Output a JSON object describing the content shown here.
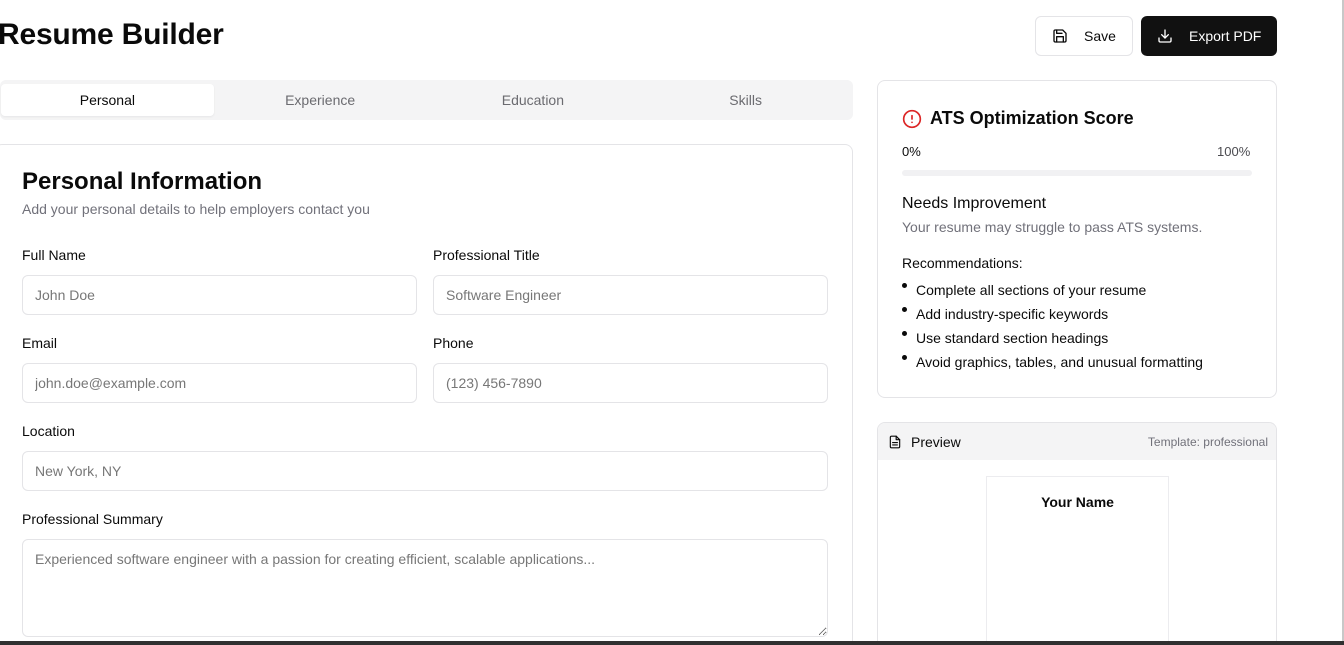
{
  "header": {
    "title": "Resume Builder",
    "save_label": "Save",
    "export_label": "Export PDF"
  },
  "tabs": [
    {
      "label": "Personal",
      "active": true
    },
    {
      "label": "Experience",
      "active": false
    },
    {
      "label": "Education",
      "active": false
    },
    {
      "label": "Skills",
      "active": false
    }
  ],
  "personal": {
    "title": "Personal Information",
    "subtitle": "Add your personal details to help employers contact you",
    "fields": {
      "full_name": {
        "label": "Full Name",
        "placeholder": "John Doe",
        "value": ""
      },
      "professional_title": {
        "label": "Professional Title",
        "placeholder": "Software Engineer",
        "value": ""
      },
      "email": {
        "label": "Email",
        "placeholder": "john.doe@example.com",
        "value": ""
      },
      "phone": {
        "label": "Phone",
        "placeholder": "(123) 456-7890",
        "value": ""
      },
      "location": {
        "label": "Location",
        "placeholder": "New York, NY",
        "value": ""
      },
      "summary": {
        "label": "Professional Summary",
        "placeholder": "Experienced software engineer with a passion for creating efficient, scalable applications...",
        "value": ""
      }
    }
  },
  "ats": {
    "title": "ATS Optimization Score",
    "min_label": "0%",
    "max_label": "100%",
    "score_percent": 0,
    "status": "Needs Improvement",
    "status_desc": "Your resume may struggle to pass ATS systems.",
    "recommendations_title": "Recommendations:",
    "recommendations": [
      "Complete all sections of your resume",
      "Add industry-specific keywords",
      "Use standard section headings",
      "Avoid graphics, tables, and unusual formatting"
    ],
    "alert_color": "#dc2626"
  },
  "preview": {
    "label": "Preview",
    "template": "Template: professional",
    "name": "Your Name"
  },
  "icons": {
    "save": "floppy-disk-icon",
    "export": "download-icon",
    "alert": "alert-circle-icon",
    "preview": "file-text-icon"
  }
}
